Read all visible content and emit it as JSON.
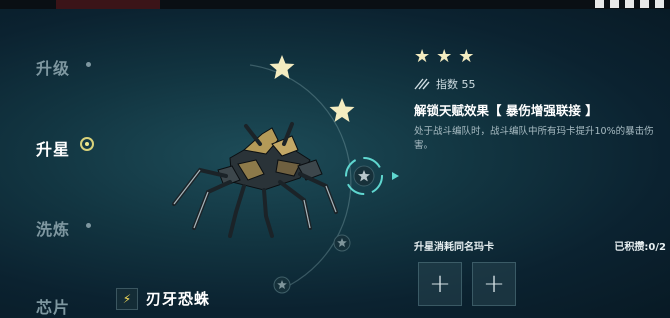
{
  "sidebar": {
    "items": [
      {
        "label": "升级",
        "state": "inactive"
      },
      {
        "label": "升星",
        "state": "active"
      },
      {
        "label": "洗炼",
        "state": "inactive"
      },
      {
        "label": "芯片",
        "state": "inactive"
      }
    ]
  },
  "star_track": {
    "filled_stars": 2,
    "total_nodes": 5,
    "current_node": "star-core"
  },
  "details": {
    "stars_filled": 3,
    "index_label": "指数 55",
    "unlock_title": "解锁天赋效果【 暴伤增强联接 】",
    "description": "处于战斗编队时，战斗编队中所有玛卡提升10%的暴击伤害。"
  },
  "consume": {
    "label": "升星消耗同名玛卡",
    "accumulated": "已积攒:0/2",
    "slots": [
      "+",
      "+"
    ]
  },
  "character": {
    "name": "刃牙恐蛛",
    "bolt_icon": "⚡"
  },
  "colors": {
    "star": "#f4ecc0",
    "accent_ring": "#d9d27a",
    "cyan": "#5fd6cf"
  }
}
